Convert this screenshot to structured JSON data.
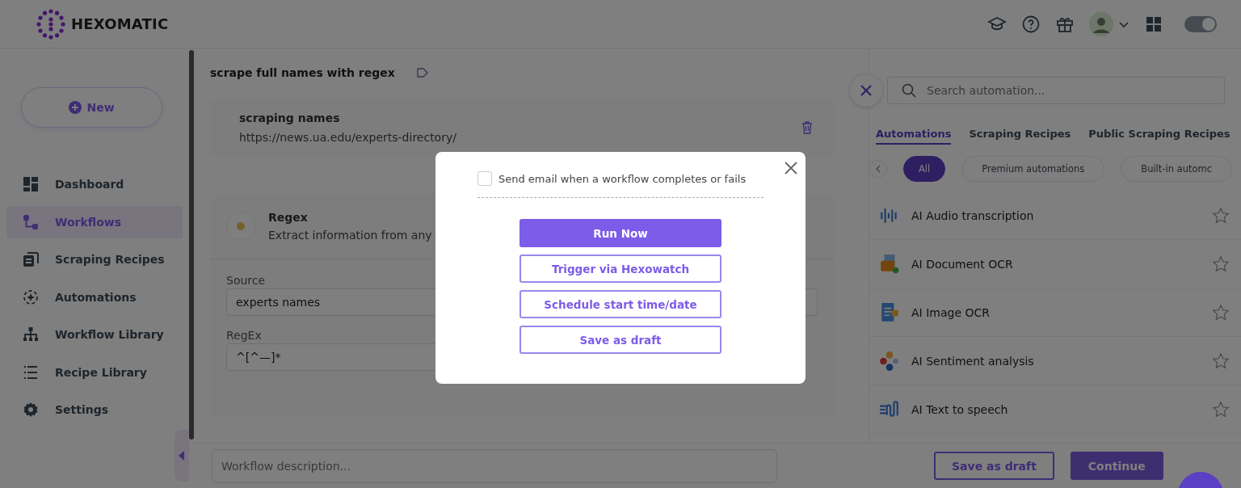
{
  "header": {
    "logo": "HEXOMATIC",
    "theme_toggle": {
      "on": true
    }
  },
  "sidebar": {
    "new_button": "New",
    "items": [
      {
        "label": "Dashboard",
        "kind": "dashboard",
        "selected": false
      },
      {
        "label": "Workflows",
        "kind": "workflows",
        "selected": true
      },
      {
        "label": "Scraping Recipes",
        "kind": "recipes",
        "selected": false
      },
      {
        "label": "Automations",
        "kind": "automations",
        "selected": false
      },
      {
        "label": "Workflow Library",
        "kind": "library",
        "selected": false
      },
      {
        "label": "Recipe Library",
        "kind": "list",
        "selected": false
      },
      {
        "label": "Settings",
        "kind": "settings",
        "selected": false
      }
    ]
  },
  "workflow": {
    "title": "scrape full names with regex",
    "source_card": {
      "title": "scraping names",
      "url": "https://news.ua.edu/experts-directory/"
    },
    "regex_card": {
      "title": "Regex",
      "description": "Extract information from any",
      "fields": [
        {
          "label": "Source",
          "value": "experts names"
        },
        {
          "label": "RegEx",
          "value": "^[^—]*"
        }
      ]
    },
    "description_placeholder": "Workflow description..."
  },
  "automation_panel": {
    "search_placeholder": "Search automation...",
    "tabs": [
      {
        "label": "Automations",
        "selected": true
      },
      {
        "label": "Scraping Recipes",
        "selected": false
      },
      {
        "label": "Public Scraping Recipes",
        "selected": false
      }
    ],
    "filters": [
      {
        "label": "All",
        "selected": true
      },
      {
        "label": "Premium automations",
        "selected": false
      },
      {
        "label": "Built-in automc",
        "selected": false
      }
    ],
    "items": [
      {
        "name": "AI Audio transcription",
        "kind": "audio"
      },
      {
        "name": "AI Document OCR",
        "kind": "document"
      },
      {
        "name": "AI Image OCR",
        "kind": "image"
      },
      {
        "name": "AI Sentiment analysis",
        "kind": "sentiment"
      },
      {
        "name": "AI Text to speech",
        "kind": "speech"
      }
    ]
  },
  "footer": {
    "buttons": [
      {
        "label": "Save as draft",
        "kind": "outline"
      },
      {
        "label": "Continue",
        "kind": "primary"
      }
    ]
  },
  "modal": {
    "checkbox": {
      "label": "Send email when a workflow completes or fails",
      "checked": false
    },
    "buttons": [
      {
        "label": "Run Now",
        "kind": "primary"
      },
      {
        "label": "Trigger via Hexowatch",
        "kind": "outline"
      },
      {
        "label": "Schedule start time/date",
        "kind": "outline"
      },
      {
        "label": "Save as draft",
        "kind": "outline"
      }
    ]
  }
}
